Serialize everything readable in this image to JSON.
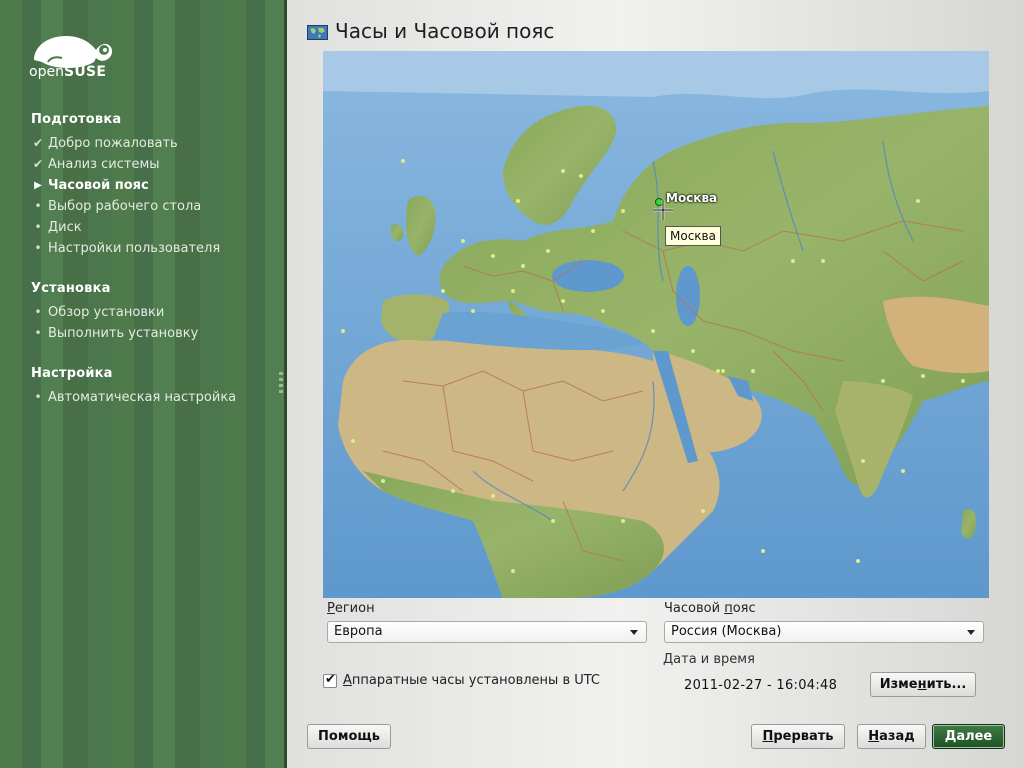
{
  "sidebar": {
    "logo_text_light": "open",
    "logo_text_bold": "SUSE",
    "sections": [
      {
        "title": "Подготовка",
        "steps": [
          {
            "label": "Добро пожаловать",
            "state": "done"
          },
          {
            "label": "Анализ системы",
            "state": "done"
          },
          {
            "label": "Часовой пояс",
            "state": "current"
          },
          {
            "label": "Выбор рабочего стола",
            "state": "pending"
          },
          {
            "label": "Диск",
            "state": "pending"
          },
          {
            "label": "Настройки пользователя",
            "state": "pending"
          }
        ]
      },
      {
        "title": "Установка",
        "steps": [
          {
            "label": "Обзор установки",
            "state": "pending"
          },
          {
            "label": "Выполнить установку",
            "state": "pending"
          }
        ]
      },
      {
        "title": "Настройка",
        "steps": [
          {
            "label": "Автоматическая настройка",
            "state": "pending"
          }
        ]
      }
    ],
    "marks": {
      "done": "✔",
      "current": "▶",
      "pending": "•"
    }
  },
  "header": {
    "title": "Часы и Часовой пояс",
    "icon": "world-map-icon"
  },
  "map": {
    "selected_city_label": "Москва",
    "tooltip": "Москва",
    "colors": {
      "sea": "#6fa6d4",
      "land": "#8fae62",
      "desert": "#cdb784",
      "border": "#b5735a"
    }
  },
  "region": {
    "label_pre": "",
    "label_u": "Р",
    "label_post": "егион",
    "value": "Европа"
  },
  "timezone": {
    "label_pre": "Часовой ",
    "label_u": "п",
    "label_post": "ояс",
    "value": "Россия (Москва)"
  },
  "utc": {
    "checked": true,
    "label_u": "А",
    "label_post": "ппаратные часы установлены в UTC"
  },
  "datetime": {
    "heading": "Дата и время",
    "value": "2011-02-27 - 16:04:48",
    "change_pre": "Изме",
    "change_u": "н",
    "change_post": "ить..."
  },
  "buttons": {
    "help": "Помощь",
    "abort_u": "П",
    "abort_post": "рервать",
    "back_u": "Н",
    "back_post": "азад",
    "next": "Далее"
  },
  "colors": {
    "sidebar": "#4e7a4c",
    "primary_button": "#2c6432"
  }
}
